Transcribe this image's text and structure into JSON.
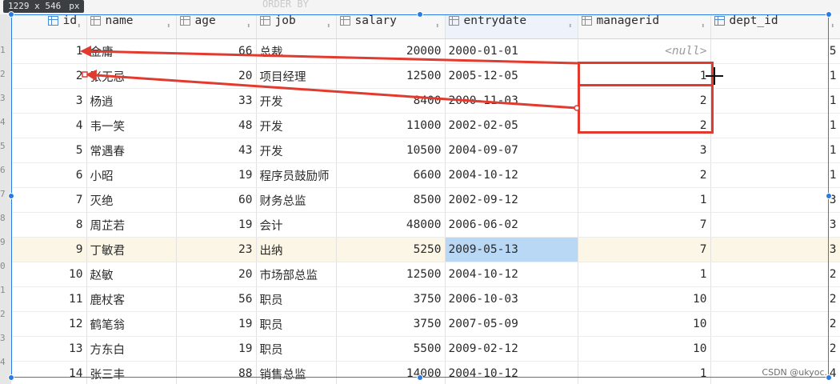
{
  "overlay": {
    "dimensions": "1229 x 546",
    "unit": "px"
  },
  "editor_ghost_text": "ORDER BY",
  "gutter_numbers": [
    "1",
    "2",
    "3",
    "4",
    "5",
    "6",
    "7",
    "8",
    "9",
    "0",
    "1",
    "2",
    "3",
    "4"
  ],
  "columns": [
    {
      "label": "id",
      "icon": "column-key-icon"
    },
    {
      "label": "name",
      "icon": "column-icon"
    },
    {
      "label": "age",
      "icon": "column-icon"
    },
    {
      "label": "job",
      "icon": "column-icon"
    },
    {
      "label": "salary",
      "icon": "column-icon"
    },
    {
      "label": "entrydate",
      "icon": "column-icon"
    },
    {
      "label": "managerid",
      "icon": "column-icon"
    },
    {
      "label": "dept_id",
      "icon": "column-foreign-key-icon"
    }
  ],
  "rows": [
    {
      "id": "1",
      "name": "金庸",
      "age": "66",
      "job": "总裁",
      "salary": "20000",
      "entrydate": "2000-01-01",
      "managerid": "<null>",
      "dept_id": "5"
    },
    {
      "id": "2",
      "name": "张无忌",
      "age": "20",
      "job": "项目经理",
      "salary": "12500",
      "entrydate": "2005-12-05",
      "managerid": "1",
      "dept_id": "1"
    },
    {
      "id": "3",
      "name": "杨逍",
      "age": "33",
      "job": "开发",
      "salary": "8400",
      "entrydate": "2000-11-03",
      "managerid": "2",
      "dept_id": "1"
    },
    {
      "id": "4",
      "name": "韦一笑",
      "age": "48",
      "job": "开发",
      "salary": "11000",
      "entrydate": "2002-02-05",
      "managerid": "2",
      "dept_id": "1"
    },
    {
      "id": "5",
      "name": "常遇春",
      "age": "43",
      "job": "开发",
      "salary": "10500",
      "entrydate": "2004-09-07",
      "managerid": "3",
      "dept_id": "1"
    },
    {
      "id": "6",
      "name": "小昭",
      "age": "19",
      "job": "程序员鼓励师",
      "salary": "6600",
      "entrydate": "2004-10-12",
      "managerid": "2",
      "dept_id": "1"
    },
    {
      "id": "7",
      "name": "灭绝",
      "age": "60",
      "job": "财务总监",
      "salary": "8500",
      "entrydate": "2002-09-12",
      "managerid": "1",
      "dept_id": "3"
    },
    {
      "id": "8",
      "name": "周芷若",
      "age": "19",
      "job": "会计",
      "salary": "48000",
      "entrydate": "2006-06-02",
      "managerid": "7",
      "dept_id": "3"
    },
    {
      "id": "9",
      "name": "丁敏君",
      "age": "23",
      "job": "出纳",
      "salary": "5250",
      "entrydate": "2009-05-13",
      "managerid": "7",
      "dept_id": "3"
    },
    {
      "id": "10",
      "name": "赵敏",
      "age": "20",
      "job": "市场部总监",
      "salary": "12500",
      "entrydate": "2004-10-12",
      "managerid": "1",
      "dept_id": "2"
    },
    {
      "id": "11",
      "name": "鹿杖客",
      "age": "56",
      "job": "职员",
      "salary": "3750",
      "entrydate": "2006-10-03",
      "managerid": "10",
      "dept_id": "2"
    },
    {
      "id": "12",
      "name": "鹤笔翁",
      "age": "19",
      "job": "职员",
      "salary": "3750",
      "entrydate": "2007-05-09",
      "managerid": "10",
      "dept_id": "2"
    },
    {
      "id": "13",
      "name": "方东白",
      "age": "19",
      "job": "职员",
      "salary": "5500",
      "entrydate": "2009-02-12",
      "managerid": "10",
      "dept_id": "2"
    },
    {
      "id": "14",
      "name": "张三丰",
      "age": "88",
      "job": "销售总监",
      "salary": "14000",
      "entrydate": "2004-10-12",
      "managerid": "1",
      "dept_id": "4"
    }
  ],
  "selected_row_index": 8,
  "selected_cell": {
    "row": 8,
    "column": "entrydate"
  },
  "annotation_color": "#e23a2e",
  "watermark": "CSDN @ukyoc."
}
